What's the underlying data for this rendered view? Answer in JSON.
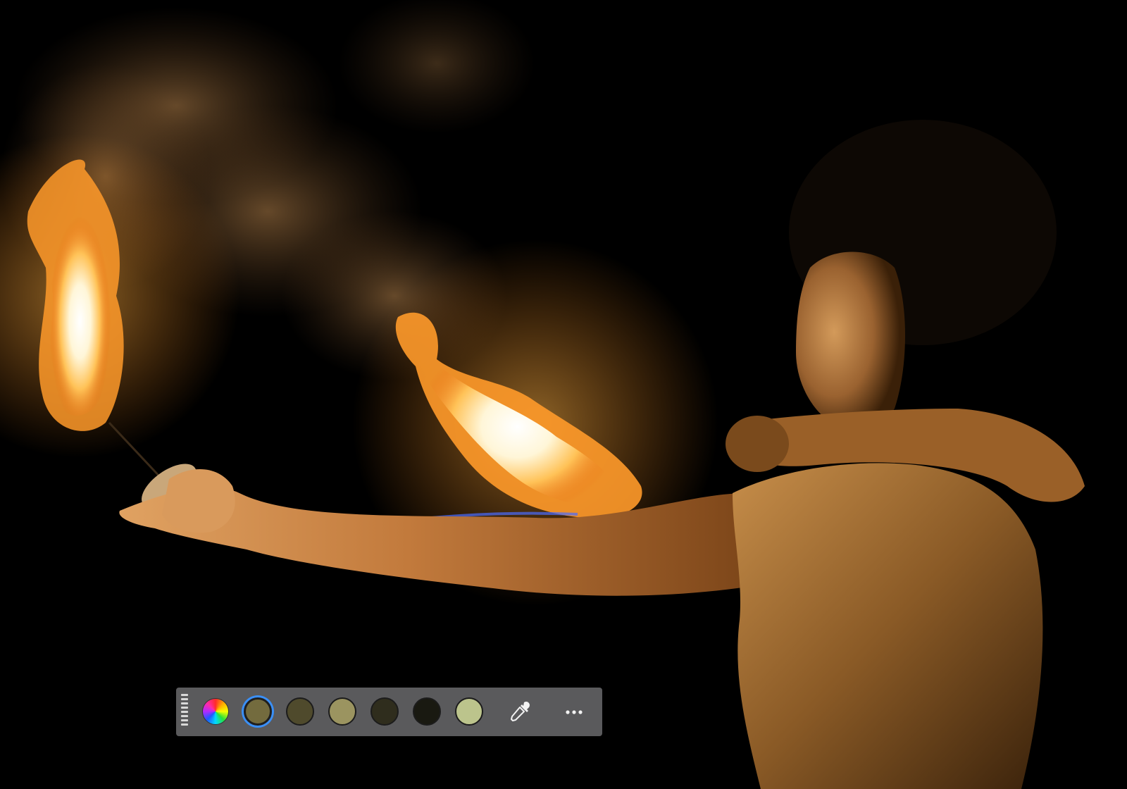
{
  "photo": {
    "subject": "fire-dancer-photo"
  },
  "palette": {
    "color_wheel_icon": "color-wheel-icon",
    "swatches": [
      {
        "color": "#736b3e",
        "selected": true
      },
      {
        "color": "#4f4a2c",
        "selected": false
      },
      {
        "color": "#9b9460",
        "selected": false
      },
      {
        "color": "#2f2d1d",
        "selected": false
      },
      {
        "color": "#191911",
        "selected": false
      },
      {
        "color": "#bcc48c",
        "selected": false
      }
    ],
    "eyedropper_icon": "eyedropper-icon",
    "more_icon": "more-options-icon",
    "colors": {
      "bar_background": "#5a5a5c",
      "selection_ring": "#3a8ff7"
    }
  }
}
